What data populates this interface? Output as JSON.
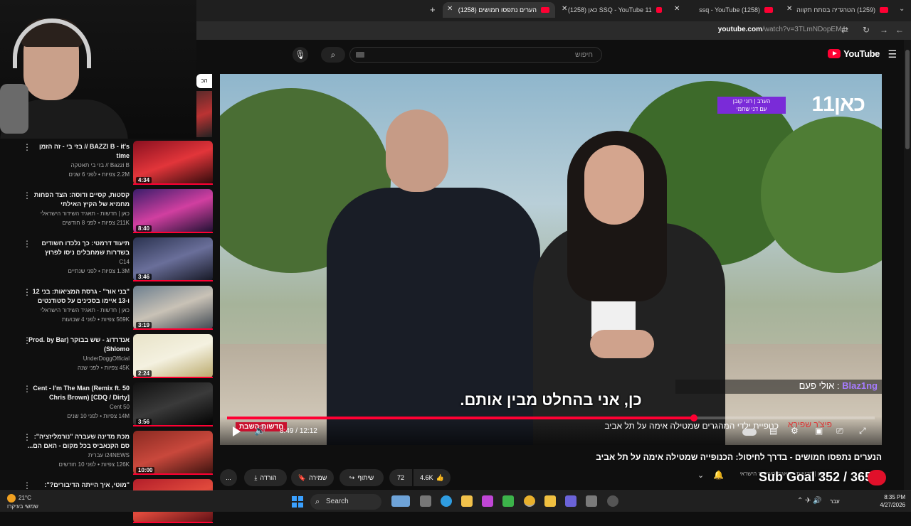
{
  "browser": {
    "tabs": [
      {
        "label": "הערים נתפסו חמושים (1258)",
        "active": true
      },
      {
        "label": "SSQ - YouTube 11 כאן (1258)",
        "active": false
      },
      {
        "label": "(1258) ssq - YouTube",
        "active": false
      },
      {
        "label": "(1259) הטרגדיה בפתח תקווה",
        "active": false
      }
    ],
    "new_tab": "+",
    "url_host": "youtube.com",
    "url_path": "/watch?v=3TLmNDopEM4"
  },
  "youtube": {
    "logo": "YouTube",
    "search_placeholder": "חיפוש",
    "chip_label": "הכ"
  },
  "recommendations": [
    {
      "title": "BAZZI B - it's // בזי בי - זה הזמן time",
      "channel": "Bazzi B // בזי בי תאטקה",
      "meta": "2.2M צפיות • לפני 6 שנים",
      "duration": "4:34",
      "colors": [
        "#8a1020",
        "#e2353a",
        "#2b0a0a"
      ]
    },
    {
      "title": "קסטות, קסיים ודוסה: הצד הפחות מחמיא של הקיץ האילתי",
      "channel": "כאן | חדשות - תאגיד השידור הישראלי",
      "meta": "211K צפיות • לפני 8 חודשים",
      "duration": "8:40",
      "colors": [
        "#3b1d6b",
        "#d13fa0",
        "#1a1030"
      ]
    },
    {
      "title": "תיעוד דרמטי: כך נלכדו חשודים בשדרות שמחבלים ניסו לפרוץ",
      "channel": "C14",
      "meta": "1.3M צפיות • לפני שנתיים",
      "duration": "3:46",
      "colors": [
        "#2b3350",
        "#6a6f9a",
        "#141622"
      ]
    },
    {
      "title": "\"בני אור\" - גרסת המציאות: בני 12 ו-13 איימו בסכינים על סטודנטים",
      "channel": "כאן | חדשות - תאגיד השידור הישראלי",
      "meta": "569K צפיות • לפני 4 שבועות",
      "duration": "3:19",
      "colors": [
        "#6d7f8f",
        "#c9c2b6",
        "#3d4650"
      ]
    },
    {
      "title": "אנדרדוג - שש בבוקר Prod. by Bar) (Shlomo",
      "channel": "UnderDoggOfficial",
      "meta": "45K צפיות • לפני שנה",
      "duration": "2:24",
      "colors": [
        "#e8e3c8",
        "#f4f1e0",
        "#b9a86a"
      ]
    },
    {
      "title": "50 Cent - I'm The Man (Remix ft. Chris Brown) [CDQ / Dirty]",
      "channel": "50 Cent",
      "meta": "14M צפיות • לפני 10 שנים",
      "duration": "3:56",
      "colors": [
        "#111111",
        "#3a3a3a",
        "#000000"
      ]
    },
    {
      "title": "מכת מדינה שעברה \"נורמליזציה\": סם הקנאביס בכל מקום - האם הם...",
      "channel": "i24NEWS עברית",
      "meta": "126K צפיות • לפני 10 חודשים",
      "duration": "10:00",
      "colors": [
        "#8a2a22",
        "#c9483c",
        "#3a120e"
      ]
    },
    {
      "title": "\"מוטי, איך הייתה הדיבורים?\": משפחות",
      "channel": "",
      "meta": "",
      "duration": "",
      "colors": [
        "#b31e2a",
        "#e14a3c",
        "#5a0e14"
      ]
    }
  ],
  "player": {
    "kan_logo": "כאן11",
    "reporter_tag_line1": "הערב | רוני קובן",
    "reporter_tag_line2": "עם דני שחמי",
    "chat_user": "Blaz1ng",
    "chat_message": "אולי פעם",
    "subtitle": "כן, אני בהחלט מבין אותם.",
    "news_label": "חדשות השבת",
    "news_ticker": "כנופיית ילדי המהגרים שמטילה אימה על תל אביב",
    "news_ticker_right": "פיצ'ר שפירא",
    "current_time": "8:49",
    "duration": "12:12",
    "progress_fraction": 0.721
  },
  "video": {
    "title": "הנערים נתפסו חמושים - בדרך לחיסול: הכנופייה שמטילה אימה על תל אביב",
    "channel": "כאן | חדשות - תאגיד השידור הישראלי",
    "likes": "4.6K",
    "dislikes": "72",
    "share_label": "שיתוף",
    "save_label": "שמירה",
    "download_label": "הורדה",
    "more_label": "..."
  },
  "overlay": {
    "sub_goal": "Sub Goal 352 / 365"
  },
  "taskbar": {
    "temperature": "21°C",
    "weather_desc": "שמשי בעיקרו",
    "search_label": "Search",
    "time": "8:35 PM",
    "date": "4/27/2026",
    "lang": "עבר"
  }
}
